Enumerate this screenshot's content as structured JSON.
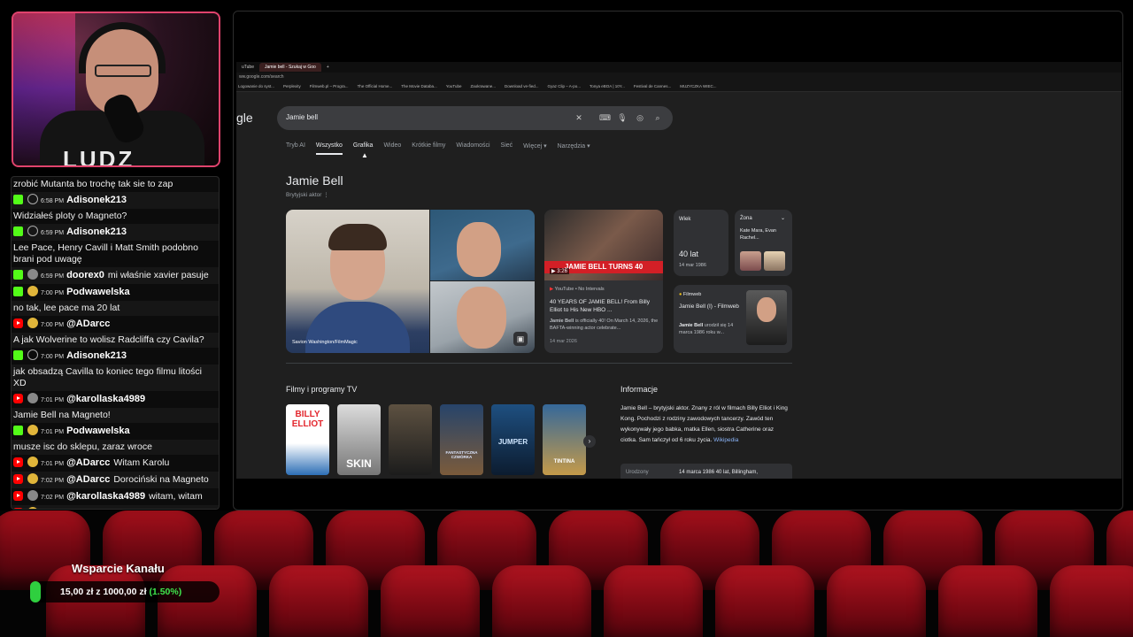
{
  "chat": {
    "messages": [
      {
        "platform": "none",
        "text": "zrobić Mutanta bo trochę tak sie to zap"
      },
      {
        "platform": "kick",
        "avatar": "person-outline",
        "time": "6:58 PM",
        "user": "Adisonek213",
        "text": ""
      },
      {
        "platform": "none",
        "text": "Widziałeś ploty o Magneto?"
      },
      {
        "platform": "kick",
        "avatar": "person-outline",
        "time": "6:59 PM",
        "user": "Adisonek213",
        "text": ""
      },
      {
        "platform": "none",
        "text": "Lee Pace, Henry Cavill i Matt Smith podobno brani pod uwagę"
      },
      {
        "platform": "kick",
        "avatar": "grey",
        "time": "6:59 PM",
        "user": "doorex0",
        "text": "mi właśnie xavier pasuje"
      },
      {
        "platform": "kick",
        "avatar": "gold",
        "time": "7:00 PM",
        "user": "Podwawelska",
        "text": ""
      },
      {
        "platform": "none",
        "text": "no tak, lee pace ma 20 lat"
      },
      {
        "platform": "yt",
        "avatar": "gold",
        "time": "7:00 PM",
        "user": "@ADarcc",
        "text": ""
      },
      {
        "platform": "none",
        "text": "A jak Wolverine to wolisz Radcliffa czy Cavila?"
      },
      {
        "platform": "kick",
        "avatar": "person-outline",
        "time": "7:00 PM",
        "user": "Adisonek213",
        "text": ""
      },
      {
        "platform": "none",
        "text": "jak obsadzą Cavilla to koniec tego filmu litości XD"
      },
      {
        "platform": "yt",
        "avatar": "grey",
        "time": "7:01 PM",
        "user": "@karollaska4989",
        "text": ""
      },
      {
        "platform": "none",
        "text": "Jamie Bell na Magneto!"
      },
      {
        "platform": "kick",
        "avatar": "gold",
        "time": "7:01 PM",
        "user": "Podwawelska",
        "text": ""
      },
      {
        "platform": "none",
        "text": "musze isc do sklepu, zaraz wroce"
      },
      {
        "platform": "yt",
        "avatar": "gold",
        "time": "7:01 PM",
        "user": "@ADarcc",
        "text": "Witam Karolu"
      },
      {
        "platform": "yt",
        "avatar": "gold",
        "time": "7:02 PM",
        "user": "@ADarcc",
        "text": "Dorociński na Magneto"
      },
      {
        "platform": "yt",
        "avatar": "grey",
        "time": "7:02 PM",
        "user": "@karollaska4989",
        "text": "witam, witam"
      },
      {
        "platform": "yt",
        "avatar": "gold",
        "time": "7:02 PM",
        "user": "@ADarcc",
        "text": "Powaga"
      }
    ]
  },
  "webcam": {
    "shirt_text": "LUDZ"
  },
  "browser": {
    "tabs": [
      "uTube",
      "Jamie bell - Szukaj w Goo"
    ],
    "url": "ww.google.com/search",
    "bookmarks": [
      "Logowanie do syst...",
      "Perplexity",
      "Filmweb.pl – Progra...",
      "The Official Home...",
      "The Movie Databa...",
      "YouTube",
      "Zaokrawane...",
      "Download ve-fied...",
      "Gyaz Clip – A-po...",
      "Tonya eBOA | 10Y...",
      "Festival de Cannes...",
      "MUZYCZKA WIEC..."
    ]
  },
  "search": {
    "logo": "gle",
    "query": "Jamie bell",
    "filters": [
      "Tryb AI",
      "Wszystko",
      "Grafika",
      "Wideo",
      "Krótkie filmy",
      "Wiadomości",
      "Sieć",
      "Więcej ▾",
      "Narzędzia ▾"
    ],
    "active_filter_index": 1,
    "hover_filter_index": 2
  },
  "entity": {
    "title": "Jamie Bell",
    "subtitle": "Brytyjski aktor",
    "image_credit": "Savion Washington/FilmMagic",
    "video": {
      "banner": "JAMIE BELL TURNS 40",
      "duration": "3:26",
      "source": "YouTube • No Intervals",
      "title": "40 YEARS OF JAMIE BELL! From Billy Elliot to His New HBO ...",
      "snippet_bold": "Jamie Bell",
      "snippet": " is officially 40! On March 14, 2026, the BAFTA-winning actor celebrate...",
      "date": "14 mar 2026"
    },
    "age": {
      "label": "Wiek",
      "value": "40 lat",
      "detail": "14 mar 1986"
    },
    "spouse": {
      "label": "Żona",
      "names": "Kate Mara, Evan Rachel..."
    },
    "filmweb": {
      "source": "Filmweb",
      "title": "Jamie Bell (I) - Filmweb",
      "snippet_bold": "Jamie Bell",
      "snippet": " urodził się 14 marca 1986 roku w..."
    }
  },
  "movies": {
    "title": "Filmy i programy TV",
    "items": [
      "BILLY ELLIOT",
      "SKIN",
      "",
      "FANTASTYCZNA CZWÓRKA",
      "JUMPER",
      "TINTINA"
    ]
  },
  "info": {
    "title": "Informacje",
    "text": "Jamie Bell – brytyjski aktor. Znany z ról w filmach Billy Elliot i King Kong. Pochodzi z rodziny zawodowych tancerzy. Zawód ten wykonywały jego babka, matka Ellen, siostra Catherine oraz ciotka. Sam tańczył od 6 roku życia.",
    "link": "Wikipedia",
    "fact_label": "Urodzony",
    "fact_value": "14 marca 1986 40 lat, Billingham,"
  },
  "support": {
    "title": "Wsparcie Kanału",
    "amount": "15,00 zł",
    "separator": "z",
    "goal": "1000,00 zł",
    "percent": "(1.50%)",
    "progress": 0.015
  },
  "colors": {
    "webcam_border": "#e0436d",
    "kick": "#53fc18",
    "youtube": "#ff0000",
    "seat": "#8b0b15",
    "support_percent": "#3fe84d"
  }
}
